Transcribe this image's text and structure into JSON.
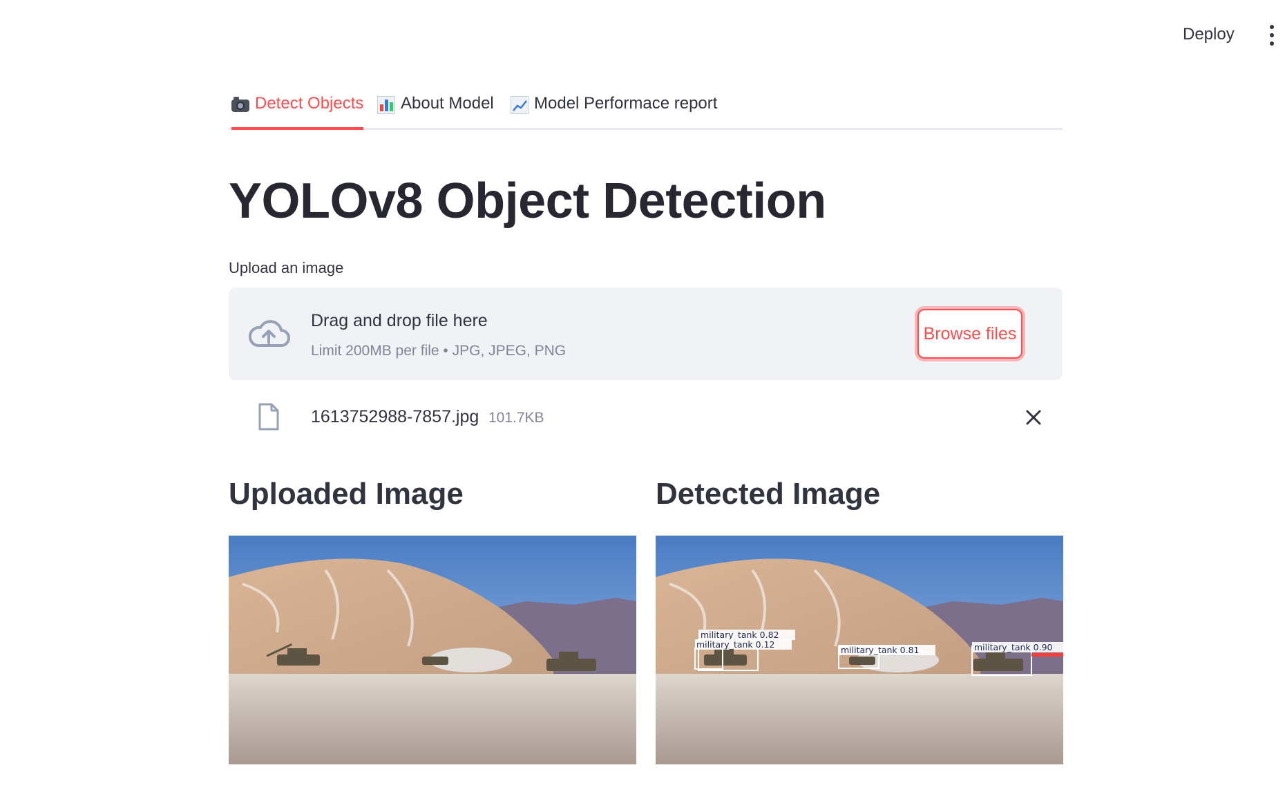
{
  "header": {
    "deploy_label": "Deploy",
    "menu_icon": "kebab-menu-icon"
  },
  "tabs": [
    {
      "label": "Detect Objects",
      "icon": "camera-icon",
      "active": true
    },
    {
      "label": "About Model",
      "icon": "bar-chart-icon",
      "active": false
    },
    {
      "label": "Model Performace report",
      "icon": "line-chart-icon",
      "active": false
    }
  ],
  "page": {
    "title": "YOLOv8 Object Detection"
  },
  "uploader": {
    "label": "Upload an image",
    "drop_text": "Drag and drop file here",
    "limit_text": "Limit 200MB per file • JPG, JPEG, PNG",
    "browse_label": "Browse files",
    "icon": "cloud-upload-icon"
  },
  "file": {
    "name": "1613752988-7857.jpg",
    "size": "101.7KB",
    "icon": "file-icon"
  },
  "columns": {
    "uploaded_heading": "Uploaded Image",
    "detected_heading": "Detected Image"
  },
  "detections": [
    {
      "label": "military_tank 0.82"
    },
    {
      "label": "military_tank 0.12"
    },
    {
      "label": "military_tank 0.81"
    },
    {
      "label": "military_tank 0.90"
    }
  ],
  "colors": {
    "accent": "#ff4b4b",
    "text": "#31333f",
    "muted": "#808495",
    "dropzone_bg": "#f0f2f6"
  }
}
